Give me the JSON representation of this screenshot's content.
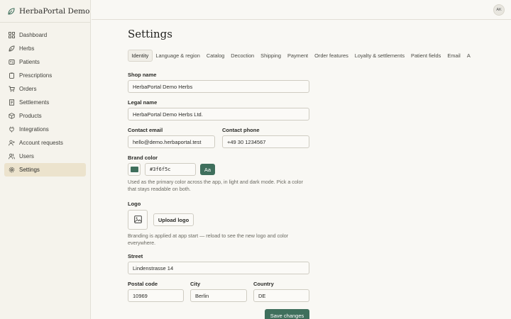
{
  "app": {
    "brand": "HerbaPortal Demo ...",
    "avatar_initials": "AK"
  },
  "sidebar": {
    "items": [
      {
        "label": "Dashboard",
        "icon": "grid-icon"
      },
      {
        "label": "Herbs",
        "icon": "leaf-icon"
      },
      {
        "label": "Patients",
        "icon": "patient-card-icon"
      },
      {
        "label": "Prescriptions",
        "icon": "clipboard-icon"
      },
      {
        "label": "Orders",
        "icon": "cart-icon"
      },
      {
        "label": "Settlements",
        "icon": "receipt-icon"
      },
      {
        "label": "Products",
        "icon": "box-icon"
      },
      {
        "label": "Integrations",
        "icon": "plug-icon"
      },
      {
        "label": "Account requests",
        "icon": "user-plus-icon"
      },
      {
        "label": "Users",
        "icon": "users-icon"
      },
      {
        "label": "Settings",
        "icon": "gear-icon",
        "active": true
      }
    ]
  },
  "page": {
    "title": "Settings"
  },
  "tabs": [
    "Identity",
    "Language & region",
    "Catalog",
    "Decoction",
    "Shipping",
    "Payment",
    "Order features",
    "Loyalty & settlements",
    "Patient fields",
    "Email",
    "A"
  ],
  "form": {
    "shop_name": {
      "label": "Shop name",
      "value": "HerbaPortal Demo Herbs"
    },
    "legal_name": {
      "label": "Legal name",
      "value": "HerbaPortal Demo Herbs Ltd."
    },
    "contact_email": {
      "label": "Contact email",
      "value": "hello@demo.herbaportal.test"
    },
    "contact_phone": {
      "label": "Contact phone",
      "value": "+49 30 1234567"
    },
    "brand_color": {
      "label": "Brand color",
      "value": "#3f6f5c",
      "preview_label": "Aa",
      "help": "Used as the primary color across the app, in light and dark mode. Pick a color that stays readable on both."
    },
    "logo": {
      "label": "Logo",
      "upload_label": "Upload logo",
      "help": "Branding is applied at app start — reload to see the new logo and color everywhere."
    },
    "street": {
      "label": "Street",
      "value": "Lindenstrasse 14"
    },
    "postal_code": {
      "label": "Postal code",
      "value": "10969"
    },
    "city": {
      "label": "City",
      "value": "Berlin"
    },
    "country": {
      "label": "Country",
      "value": "DE"
    },
    "save_label": "Save changes"
  },
  "colors": {
    "accent": "#3f6f5c",
    "active_nav": "#ece3cd",
    "background": "#f9f8f4"
  }
}
